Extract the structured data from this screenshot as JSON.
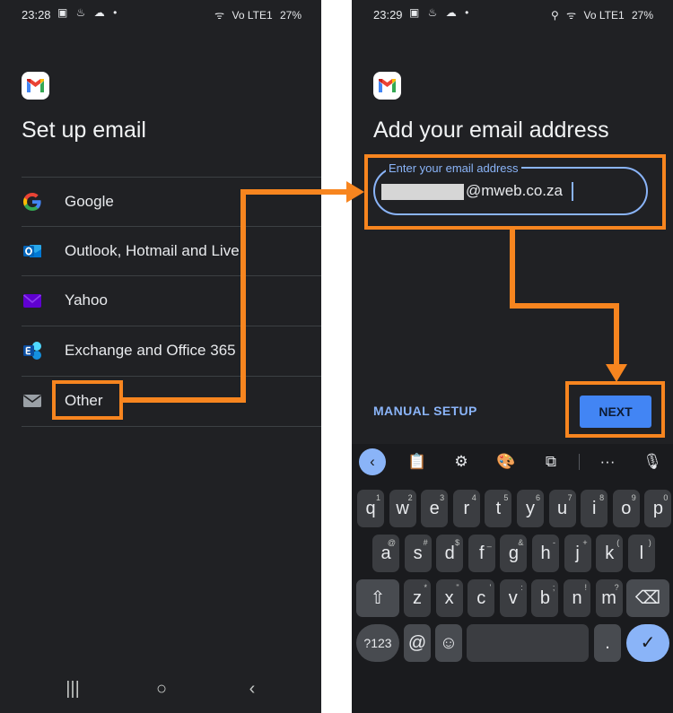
{
  "left_screen": {
    "status": {
      "time": "23:28",
      "icons": "▣ ♨ ☁ •",
      "signal": "ᯤ",
      "network": "Vo LTE1",
      "battery": "27%"
    },
    "title": "Set up email",
    "providers": [
      {
        "label": "Google",
        "icon": "google-icon"
      },
      {
        "label": "Outlook, Hotmail and Live",
        "icon": "outlook-icon"
      },
      {
        "label": "Yahoo",
        "icon": "yahoo-icon"
      },
      {
        "label": "Exchange and Office 365",
        "icon": "exchange-icon"
      },
      {
        "label": "Other",
        "icon": "mail-icon"
      }
    ]
  },
  "right_screen": {
    "status": {
      "time": "23:29",
      "icons": "▣ ♨ ☁ •",
      "location": "⚲",
      "signal": "ᯤ",
      "network": "Vo LTE1",
      "battery": "27%"
    },
    "title": "Add your email address",
    "email_field": {
      "label": "Enter your email address",
      "value": "@mweb.co.za"
    },
    "manual_setup": "MANUAL SETUP",
    "next": "NEXT",
    "keyboard": {
      "toolbar": [
        "‹",
        "📋",
        "⚙",
        "🎨",
        "⧉",
        "···",
        "🎙"
      ],
      "row1": [
        {
          "k": "q",
          "h": "1"
        },
        {
          "k": "w",
          "h": "2"
        },
        {
          "k": "e",
          "h": "3"
        },
        {
          "k": "r",
          "h": "4"
        },
        {
          "k": "t",
          "h": "5"
        },
        {
          "k": "y",
          "h": "6"
        },
        {
          "k": "u",
          "h": "7"
        },
        {
          "k": "i",
          "h": "8"
        },
        {
          "k": "o",
          "h": "9"
        },
        {
          "k": "p",
          "h": "0"
        }
      ],
      "row2": [
        {
          "k": "a",
          "h": "@"
        },
        {
          "k": "s",
          "h": "#"
        },
        {
          "k": "d",
          "h": "$"
        },
        {
          "k": "f",
          "h": "_"
        },
        {
          "k": "g",
          "h": "&"
        },
        {
          "k": "h",
          "h": "-"
        },
        {
          "k": "j",
          "h": "+"
        },
        {
          "k": "k",
          "h": "("
        },
        {
          "k": "l",
          "h": ")"
        }
      ],
      "row3": [
        {
          "k": "z",
          "h": "*"
        },
        {
          "k": "x",
          "h": "\""
        },
        {
          "k": "c",
          "h": "'"
        },
        {
          "k": "v",
          "h": ":"
        },
        {
          "k": "b",
          "h": ";"
        },
        {
          "k": "n",
          "h": "!"
        },
        {
          "k": "m",
          "h": "?"
        }
      ],
      "shift": "⇧",
      "delete": "⌫",
      "symbols": "?123",
      "at": "@",
      "emoji": "☺",
      "period": ".",
      "enter": "✓"
    }
  },
  "nav": {
    "recents": "|||",
    "home": "○",
    "back": "‹",
    "hide_keyboard": "⌄"
  },
  "colors": {
    "background": "#202124",
    "accent": "#8ab4f8",
    "button": "#4285f4",
    "annotation": "#f7851f"
  }
}
